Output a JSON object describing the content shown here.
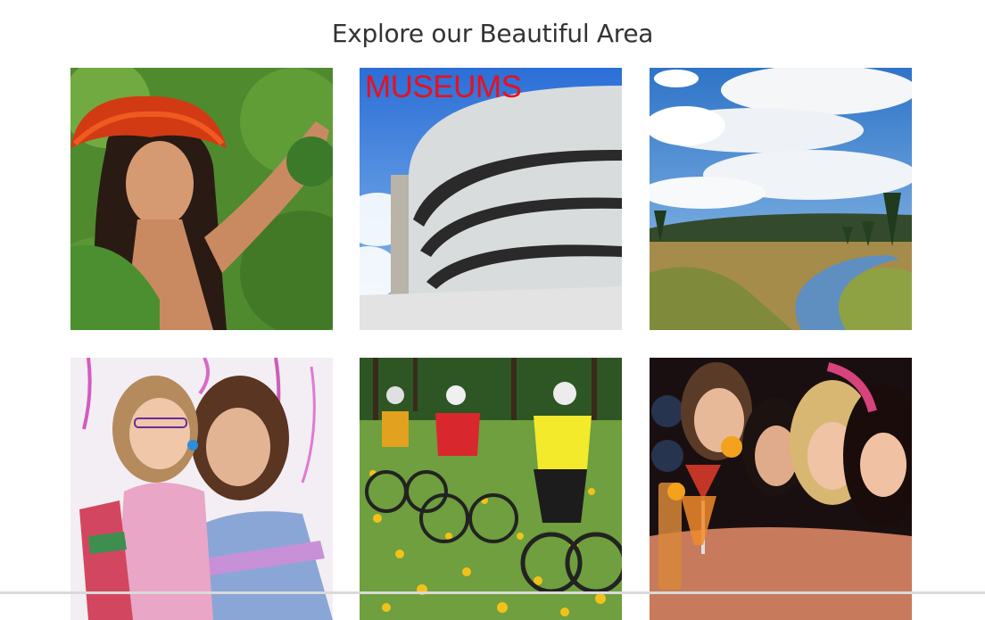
{
  "page": {
    "title": "Explore our Beautiful Area"
  },
  "tiles": [
    {
      "id": "hula-dancer",
      "label": ""
    },
    {
      "id": "museums",
      "label": "MUSEUMS"
    },
    {
      "id": "river-meadow",
      "label": ""
    },
    {
      "id": "family-photobooth",
      "label": ""
    },
    {
      "id": "mountain-biking",
      "label": ""
    },
    {
      "id": "nightlife-drinks",
      "label": ""
    }
  ],
  "colors": {
    "title": "#333333",
    "museums_label": "#e8101e"
  }
}
